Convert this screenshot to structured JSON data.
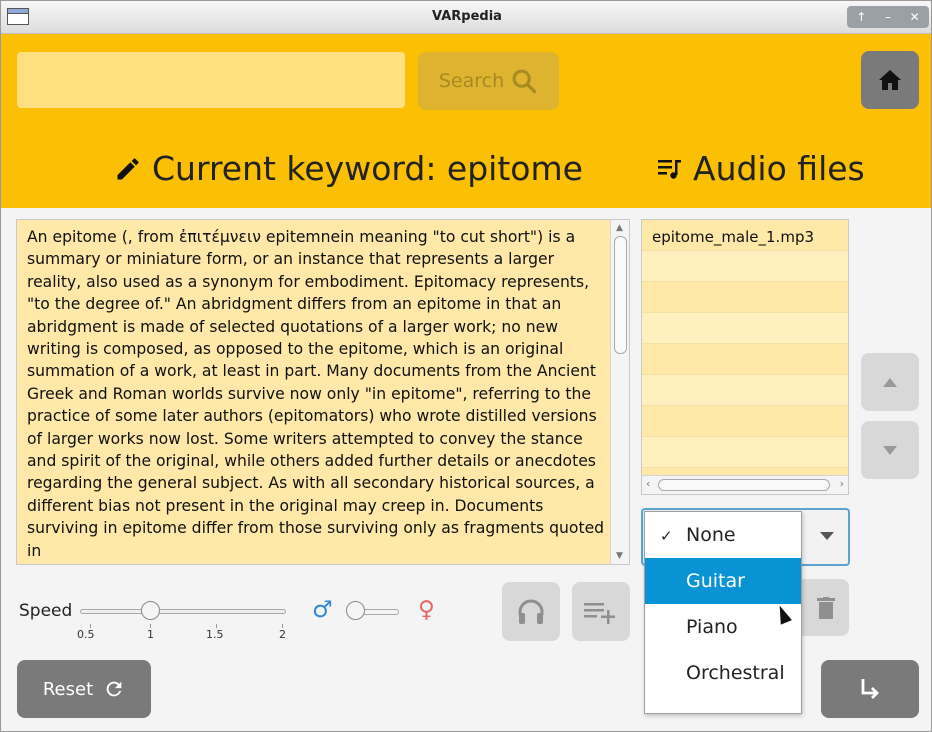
{
  "window": {
    "title": "VARpedia",
    "controls": [
      "↑",
      "–",
      "✕"
    ]
  },
  "search": {
    "placeholder": "",
    "button_label": "Search"
  },
  "header": {
    "keyword_label": "Current keyword: epitome",
    "audio_files_label": "Audio files"
  },
  "text_content": "An epitome (, from ἐπιτέμνειν epitemnein meaning \"to cut short\") is a summary or miniature form, or an instance that represents a larger reality, also used as a synonym for embodiment. Epitomacy represents, \"to the degree of.\" An abridgment differs from an epitome in that an abridgment is made of selected quotations of a larger work; no new writing is composed, as opposed to the epitome, which is an original summation of a work, at least in part. Many documents from the Ancient Greek and Roman worlds survive now only \"in epitome\", referring to the practice of some later authors (epitomators) who wrote distilled versions of larger works now lost. Some writers attempted to convey the stance and spirit of the original, while others added further details or anecdotes regarding the general subject. As with all secondary historical sources, a different bias not present in the original may creep in. Documents surviving in epitome differ from those surviving only as fragments quoted in",
  "audio_files": [
    "epitome_male_1.mp3",
    "",
    "",
    "",
    "",
    "",
    "",
    "",
    ""
  ],
  "music_dropdown": {
    "selected": "None",
    "highlighted": "Guitar",
    "options": [
      {
        "label": "None",
        "checked": true
      },
      {
        "label": "Guitar",
        "checked": false
      },
      {
        "label": "Piano",
        "checked": false
      },
      {
        "label": "Orchestral",
        "checked": false
      }
    ]
  },
  "speed": {
    "label": "Speed",
    "value": 1,
    "min": 0.5,
    "max": 2,
    "ticks": [
      "0.5",
      "1",
      "1.5",
      "2"
    ]
  },
  "voice": {
    "male_symbol": "♂",
    "female_symbol": "♀",
    "value": "male"
  },
  "buttons": {
    "reset_label": "Reset"
  },
  "icons": {
    "search": "search-icon",
    "home": "home-icon",
    "pencil": "pencil-icon",
    "audio": "playlist-music-icon",
    "up": "caret-up-icon",
    "down": "caret-down-icon",
    "headphones": "headphones-icon",
    "add_playlist": "playlist-add-icon",
    "delete": "trash-icon",
    "reset": "refresh-icon",
    "next": "arrow-turn-right-icon"
  },
  "colors": {
    "header": "#fbbf04",
    "text_bg": "#ffe8a8",
    "selected": "#0a93d4",
    "male": "#3388d6",
    "female": "#e36a6a"
  }
}
